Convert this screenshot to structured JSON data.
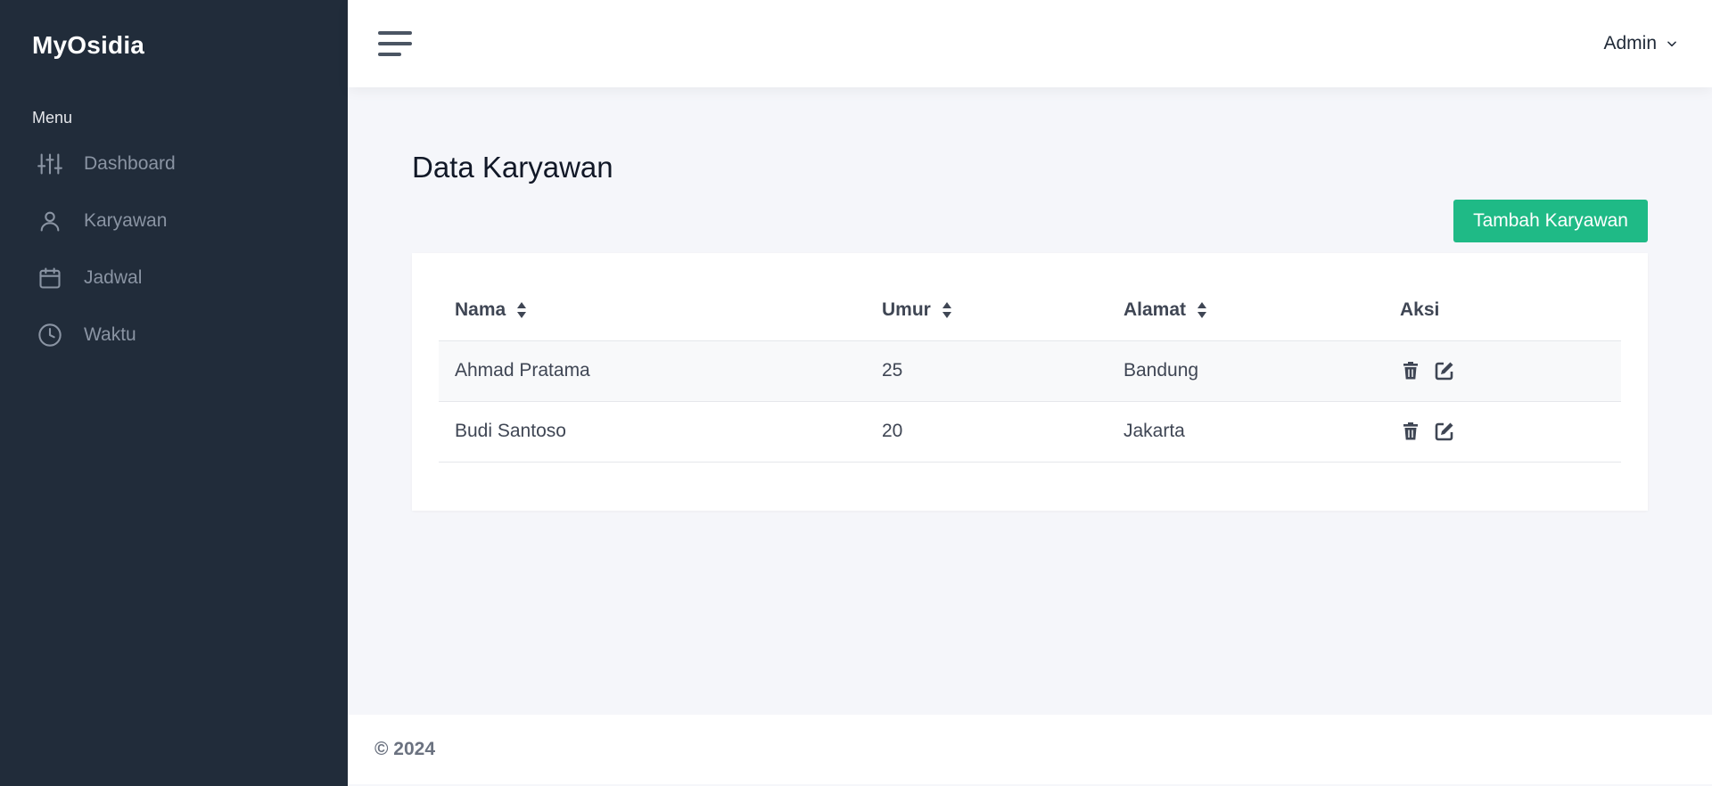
{
  "sidebar": {
    "brand": "MyOsidia",
    "menu_heading": "Menu",
    "items": [
      {
        "label": "Dashboard",
        "icon": "sliders-icon"
      },
      {
        "label": "Karyawan",
        "icon": "user-icon"
      },
      {
        "label": "Jadwal",
        "icon": "calendar-icon"
      },
      {
        "label": "Waktu",
        "icon": "clock-icon"
      }
    ]
  },
  "topbar": {
    "user_label": "Admin"
  },
  "main": {
    "title": "Data Karyawan",
    "add_button_label": "Tambah Karyawan",
    "table": {
      "headers": [
        "Nama",
        "Umur",
        "Alamat",
        "Aksi"
      ],
      "rows": [
        {
          "nama": "Ahmad Pratama",
          "umur": "25",
          "alamat": "Bandung"
        },
        {
          "nama": "Budi Santoso",
          "umur": "20",
          "alamat": "Jakarta"
        }
      ]
    }
  },
  "footer": {
    "text": "© 2024"
  },
  "colors": {
    "sidebar_bg": "#212c3a",
    "accent": "#1fba86",
    "page_bg": "#f5f6fa"
  }
}
